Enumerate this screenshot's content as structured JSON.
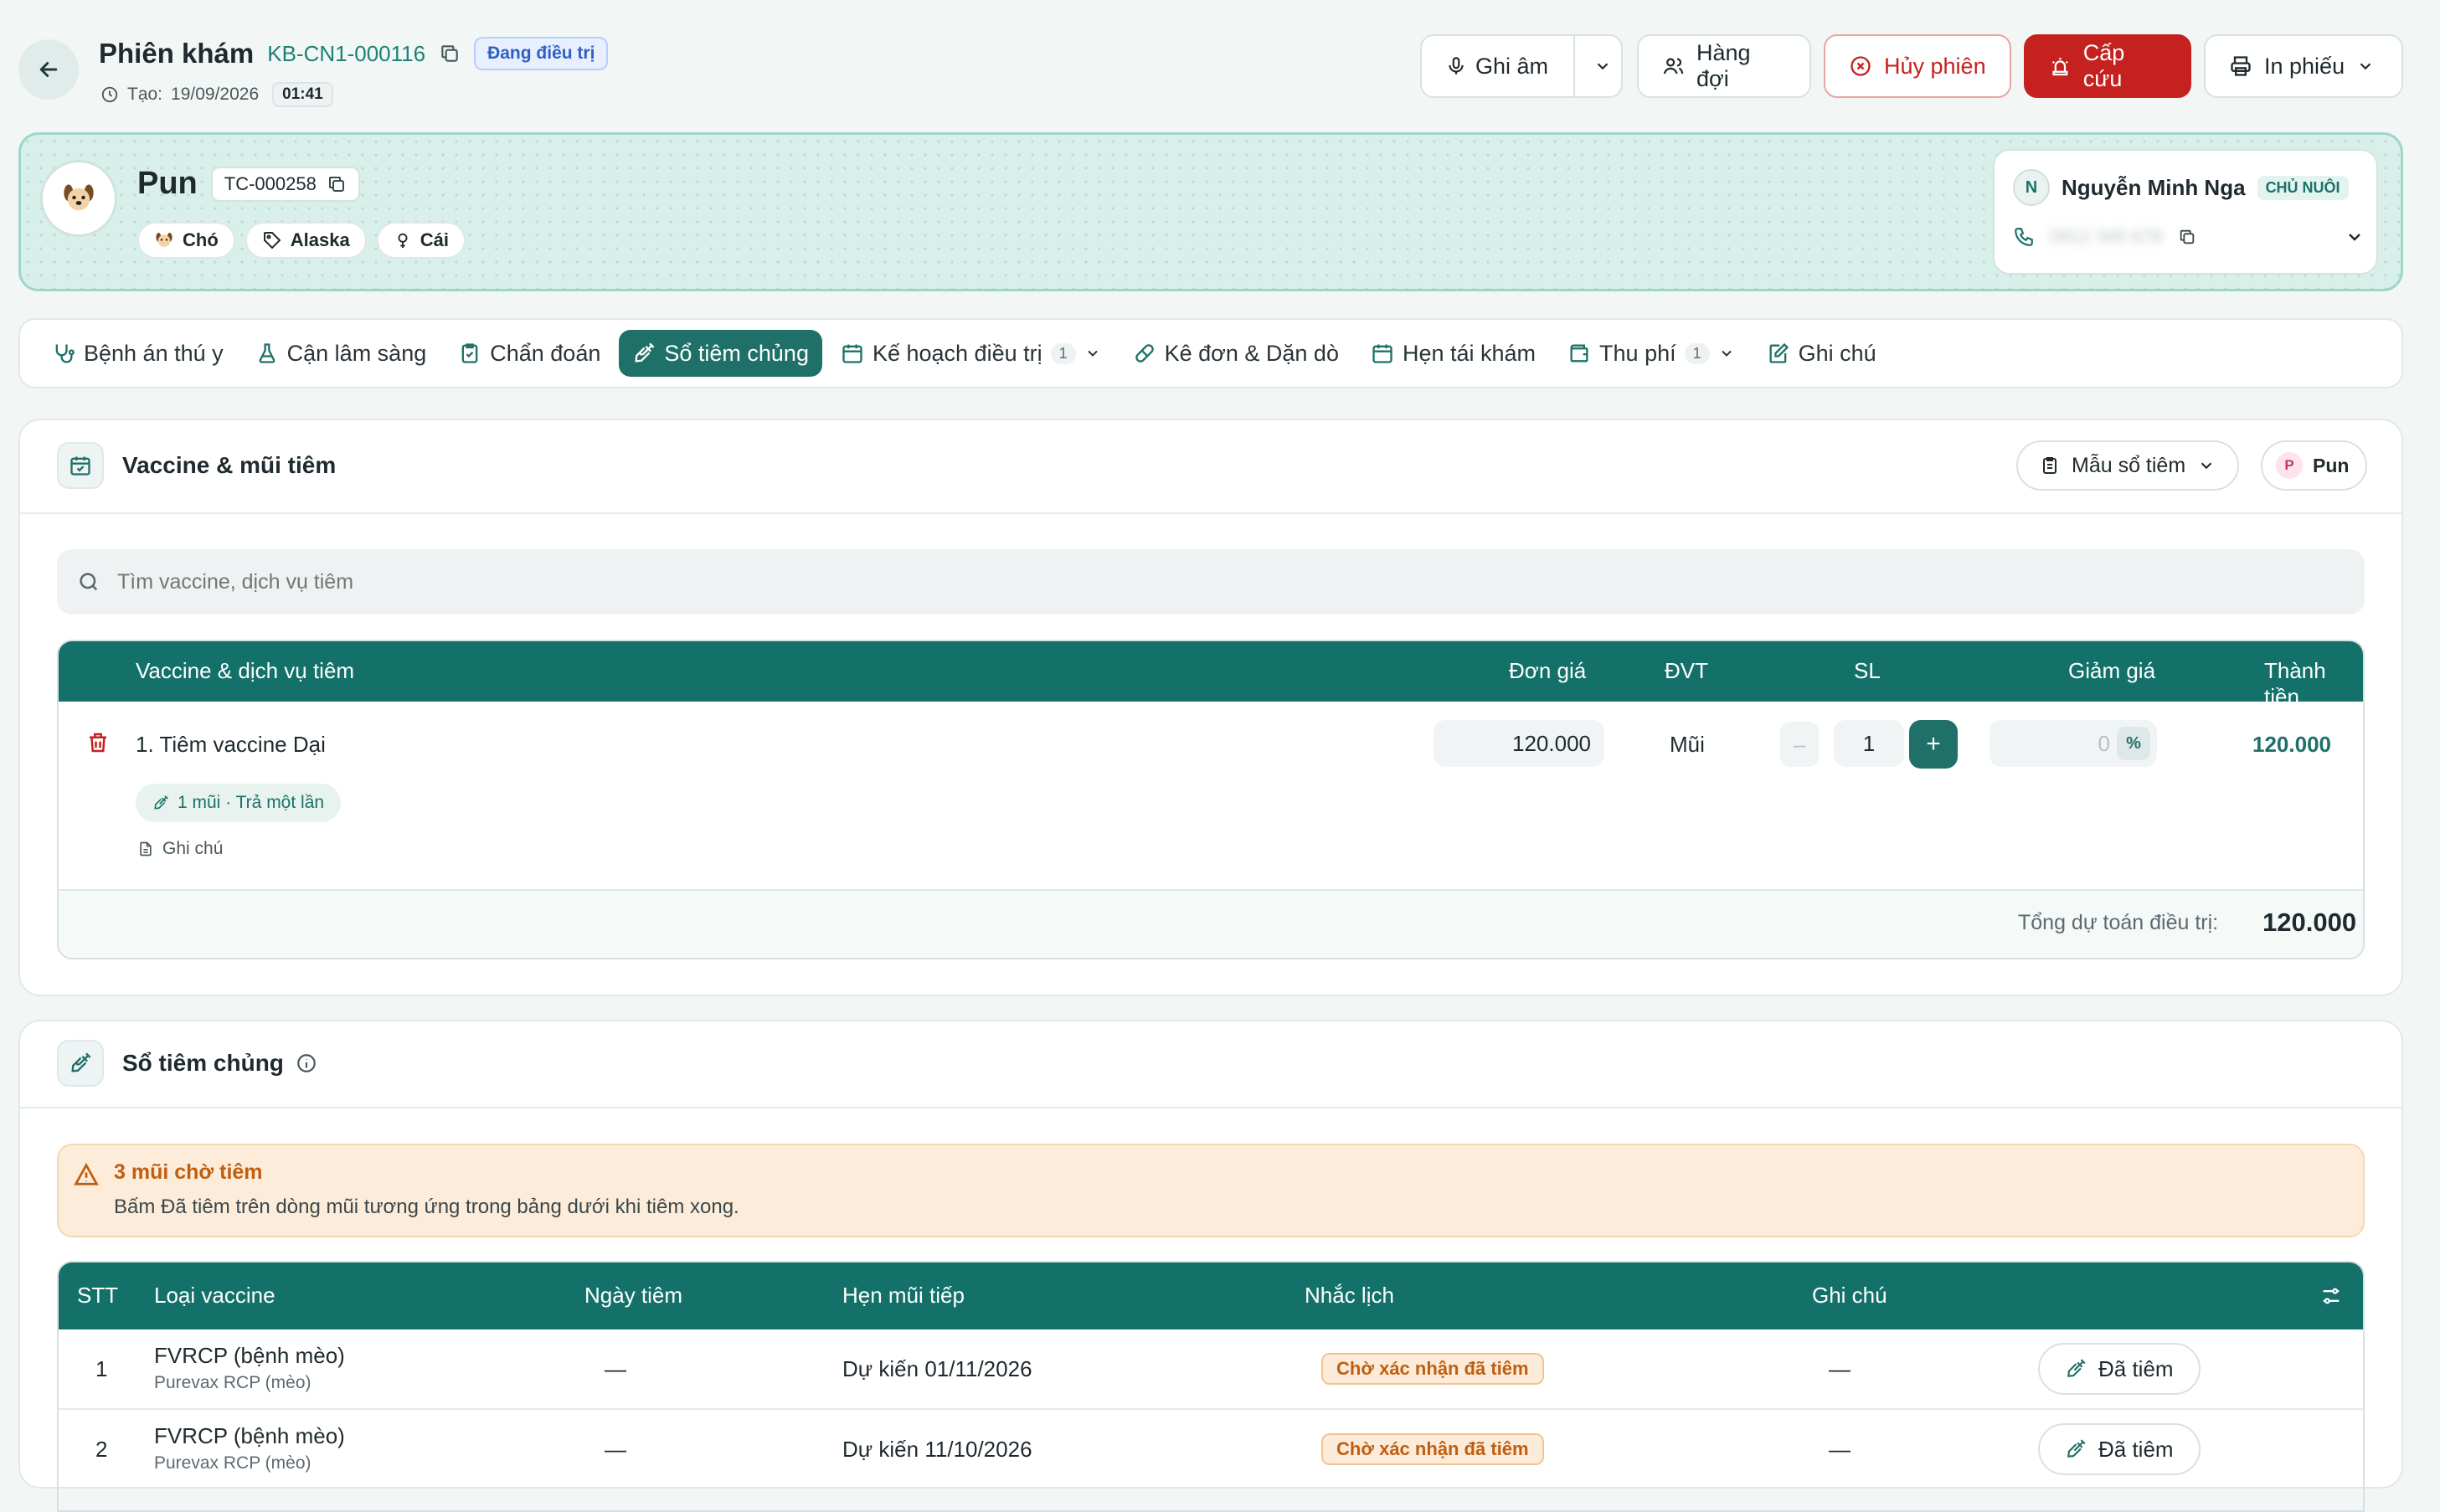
{
  "header": {
    "title": "Phiên khám",
    "session_code": "KB-CN1-000116",
    "status": "Đang điều trị",
    "created_label": "Tạo:",
    "created_date": "19/09/2026",
    "created_time": "01:41"
  },
  "actions": {
    "record_label": "Ghi âm",
    "queue_label": "Hàng đợi",
    "cancel_label": "Hủy phiên",
    "emergency_label": "Cấp cứu",
    "print_label": "In phiếu"
  },
  "pet": {
    "name": "Pun",
    "code": "TC-000258",
    "species": "Chó",
    "breed": "Alaska",
    "sex": "Cái"
  },
  "owner": {
    "initial": "N",
    "name": "Nguyễn Minh Nga",
    "role": "CHỦ NUÔI",
    "phone": "0912 345 678"
  },
  "tabs": [
    {
      "label": "Bệnh án thú y"
    },
    {
      "label": "Cận lâm sàng"
    },
    {
      "label": "Chẩn đoán"
    },
    {
      "label": "Sổ tiêm chủng"
    },
    {
      "label": "Kế hoạch điều trị",
      "count": "1"
    },
    {
      "label": "Kê đơn & Dặn dò"
    },
    {
      "label": "Hẹn tái khám"
    },
    {
      "label": "Thu phí",
      "count": "1"
    },
    {
      "label": "Ghi chú"
    }
  ],
  "vaccine_section": {
    "title": "Vaccine & mũi tiêm",
    "template_label": "Mẫu sổ tiêm",
    "pet_chip_initial": "P",
    "pet_chip_name": "Pun",
    "search_placeholder": "Tìm vaccine, dịch vụ tiêm",
    "columns": {
      "service": "Vaccine & dịch vụ tiêm",
      "unit_price": "Đơn giá",
      "unit": "ĐVT",
      "qty": "SL",
      "discount": "Giảm giá",
      "total": "Thành tiền"
    },
    "items": [
      {
        "name": "1. Tiêm vaccine Dại",
        "dose_tag": "1 mũi · Trả một lần",
        "note_label": "Ghi chú",
        "unit_price": "120.000",
        "unit": "Mũi",
        "qty_minus": "–",
        "qty": "1",
        "qty_plus": "+",
        "discount": "0",
        "discount_unit": "%",
        "total": "120.000"
      }
    ],
    "summary_label": "Tổng dự toán điều trị:",
    "summary_value": "120.000"
  },
  "vaccination_book": {
    "title": "Sổ tiêm chủng",
    "alert_title": "3 mũi chờ tiêm",
    "alert_body": "Bấm Đã tiêm trên dòng mũi tương ứng trong bảng dưới khi tiêm xong.",
    "columns": {
      "index": "STT",
      "type": "Loại vaccine",
      "date": "Ngày tiêm",
      "next": "Hẹn mũi tiếp",
      "reminder": "Nhắc lịch",
      "note": "Ghi chú"
    },
    "rows": [
      {
        "index": "1",
        "type": "FVRCP (bệnh mèo)",
        "product": "Purevax RCP (mèo)",
        "date": "—",
        "next": "Dự kiến 01/11/2026",
        "reminder": "Chờ xác nhận đã tiêm",
        "note": "—",
        "action": "Đã tiêm"
      },
      {
        "index": "2",
        "type": "FVRCP (bệnh mèo)",
        "product": "Purevax RCP (mèo)",
        "date": "—",
        "next": "Dự kiến 11/10/2026",
        "reminder": "Chờ xác nhận đã tiêm",
        "note": "—",
        "action": "Đã tiêm"
      }
    ]
  },
  "colors": {
    "primary": "#13716a",
    "danger": "#c4211f",
    "warning_bg": "#fcecd9",
    "warning_text": "#c05e10"
  }
}
